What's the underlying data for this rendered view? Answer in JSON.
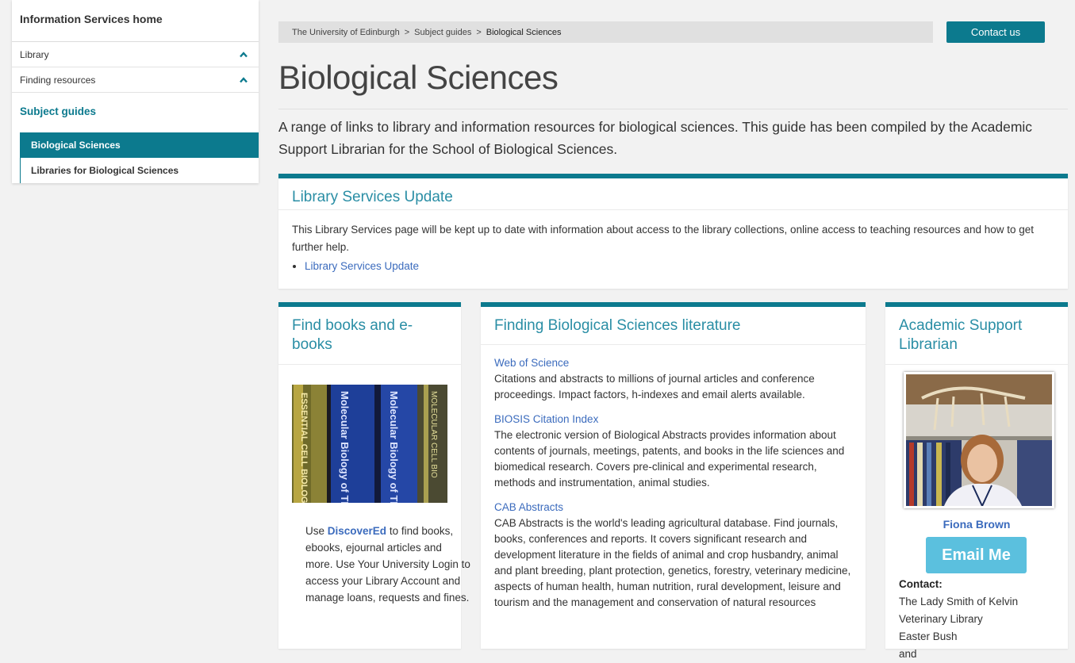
{
  "sidebar": {
    "home": "Information Services home",
    "library": "Library",
    "finding_resources": "Finding resources",
    "subject_guides": "Subject guides",
    "active_item": "Biological Sciences",
    "item2": "Libraries for Biological Sciences"
  },
  "breadcrumb": {
    "crumb1": "The University of Edinburgh",
    "crumb2": "Subject guides",
    "current": "Biological Sciences",
    "separator": ">"
  },
  "contact_button": "Contact us",
  "page": {
    "title": "Biological Sciences",
    "intro": "A range of links to library and information resources for biological sciences. This guide has been compiled by the Academic Support Librarian for the School of Biological Sciences."
  },
  "update_panel": {
    "heading": "Library Services Update",
    "text": "This Library Services page will be kept up to date with information about access to the library collections, online access to teaching resources and how to get further help.",
    "link": "Library Services Update"
  },
  "books_panel": {
    "heading": "Find books and e-books",
    "text_before": "Use ",
    "link": "DiscoverEd",
    "text_after": " to find books, ebooks, ejournal articles and more. Use Your University Login to access your Library Account and manage loans, requests and fines.",
    "book_spines": [
      "ESSENTIAL CELL BIOLOGY",
      "Molecular Biology of THE CELL",
      "Molecular Biology of THE CELL",
      "MOLECULAR CELL BIO"
    ]
  },
  "lit_panel": {
    "heading": "Finding Biological Sciences literature",
    "entries": [
      {
        "title": "Web of Science",
        "desc": "Citations and abstracts to millions of journal articles and conference proceedings. Impact factors, h-indexes and email alerts available."
      },
      {
        "title": "BIOSIS Citation Index",
        "desc": "The electronic version of Biological Abstracts provides information about contents of journals, meetings, patents, and books in the life sciences and biomedical research. Covers pre-clinical and experimental research, methods and instrumentation, animal studies."
      },
      {
        "title": "CAB Abstracts",
        "desc": "CAB Abstracts is the world's leading agricultural database. Find journals, books, conferences and reports. It covers significant research and development literature in the fields of animal and crop husbandry, animal and plant breeding, plant protection, genetics, forestry, veterinary medicine, aspects of human health, human nutrition, rural development, leisure and tourism and the management and conservation of natural resources"
      }
    ]
  },
  "librarian_panel": {
    "heading": "Academic Support Librarian",
    "name": "Fiona Brown",
    "email_button": "Email Me",
    "contact_label": "Contact:",
    "contact_lines": [
      "The Lady Smith of Kelvin",
      "Veterinary Library",
      "Easter Bush",
      "and"
    ]
  },
  "colors": {
    "accent": "#0c7a8e",
    "link": "#3b6bbd",
    "email_button": "#5bc0de"
  }
}
